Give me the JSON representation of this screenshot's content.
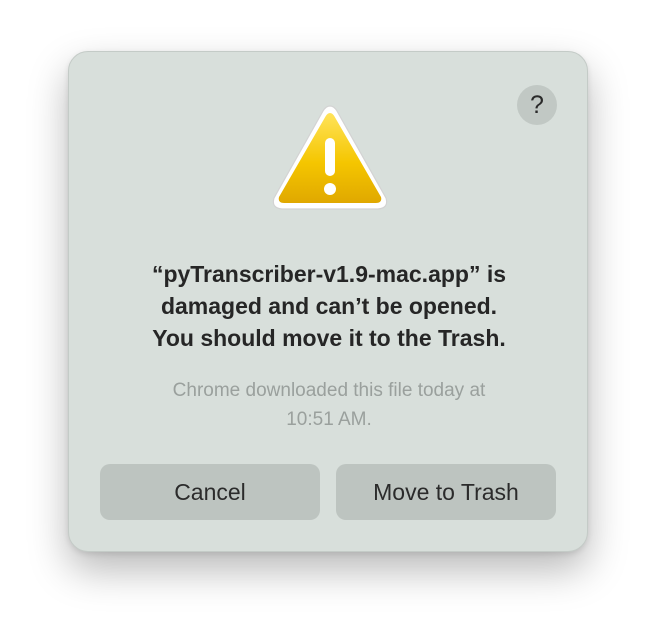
{
  "dialog": {
    "help_label": "?",
    "icon": "warning-triangle-icon",
    "message_lines": [
      "“pyTranscriber-v1.9-mac.app” is",
      "damaged and can’t be opened.",
      "You should move it to the Trash."
    ],
    "info_lines": [
      "Chrome downloaded this file today at",
      "10:51 AM."
    ],
    "buttons": {
      "cancel": "Cancel",
      "move_to_trash": "Move to Trash"
    }
  },
  "colors": {
    "dialog_bg": "#d8dfdb",
    "button_bg": "#bdc4c0",
    "warning_yellow": "#f2c200"
  }
}
